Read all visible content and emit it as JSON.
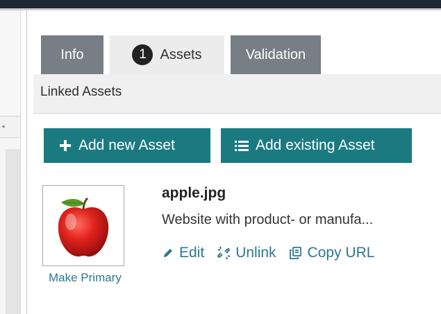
{
  "tabs": [
    {
      "label": "Info"
    },
    {
      "label": "Assets",
      "badge": "1",
      "active": true
    },
    {
      "label": "Validation"
    }
  ],
  "section": {
    "title": "Linked Assets"
  },
  "buttons": {
    "add_new": {
      "label": "Add new Asset",
      "icon": "plus-icon"
    },
    "add_existing": {
      "label": "Add existing Asset",
      "icon": "list-icon"
    }
  },
  "asset": {
    "name": "apple.jpg",
    "description": "Website with product- or manufa...",
    "thumbnail_icon": "apple-image",
    "make_primary_label": "Make Primary",
    "actions": [
      {
        "label": "Edit",
        "icon": "pencil-icon"
      },
      {
        "label": "Unlink",
        "icon": "unlink-icon"
      },
      {
        "label": "Copy URL",
        "icon": "copy-icon"
      }
    ]
  },
  "colors": {
    "accent": "#1a7a80",
    "link": "#2c7890",
    "tab_inactive": "#777e85",
    "tab_active": "#ececec",
    "topbar": "#1f2933"
  }
}
